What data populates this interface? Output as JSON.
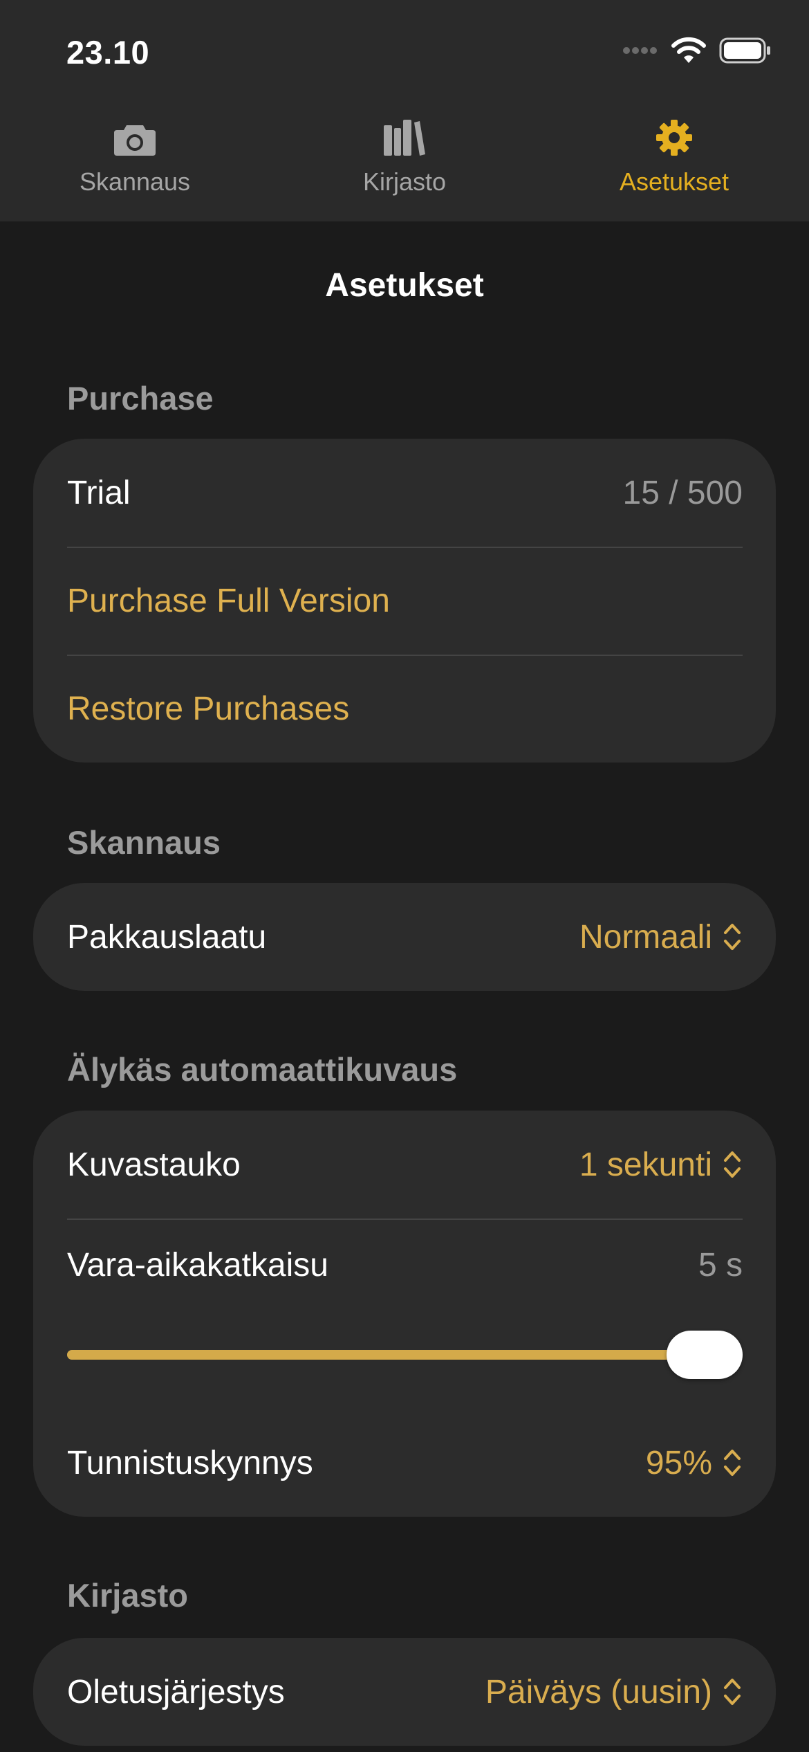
{
  "status_bar": {
    "time": "23.10",
    "icons": [
      "cellular-signal-icon",
      "wifi-icon",
      "battery-icon"
    ]
  },
  "tabs": [
    {
      "label": "Skannaus",
      "icon": "camera-icon",
      "active": false
    },
    {
      "label": "Kirjasto",
      "icon": "books-icon",
      "active": false
    },
    {
      "label": "Asetukset",
      "icon": "gear-icon",
      "active": true
    }
  ],
  "nav": {
    "title": "Asetukset"
  },
  "sections": {
    "purchase": {
      "header": "Purchase",
      "trial_label": "Trial",
      "trial_value": "15 / 500",
      "buy_label": "Purchase Full Version",
      "restore_label": "Restore Purchases"
    },
    "scanning": {
      "header": "Skannaus",
      "quality_label": "Pakkauslaatu",
      "quality_value": "Normaali"
    },
    "auto_capture": {
      "header": "Älykäs automaattikuvaus",
      "pause_label": "Kuvastauko",
      "pause_value": "1 sekunti",
      "timeout_label": "Vara-aikakatkaisu",
      "timeout_value": "5 s",
      "timeout_slider_fraction": 1.0,
      "threshold_label": "Tunnistuskynnys",
      "threshold_value": "95%"
    },
    "library": {
      "header": "Kirjasto",
      "sort_label": "Oletusjärjestys",
      "sort_value": "Päiväys (uusin)"
    }
  },
  "colors": {
    "accent": "#e5b020",
    "accent_text": "#dfb14f",
    "background": "#1b1b1b",
    "card": "#2c2c2c",
    "header_text": "#9b9b9b"
  }
}
